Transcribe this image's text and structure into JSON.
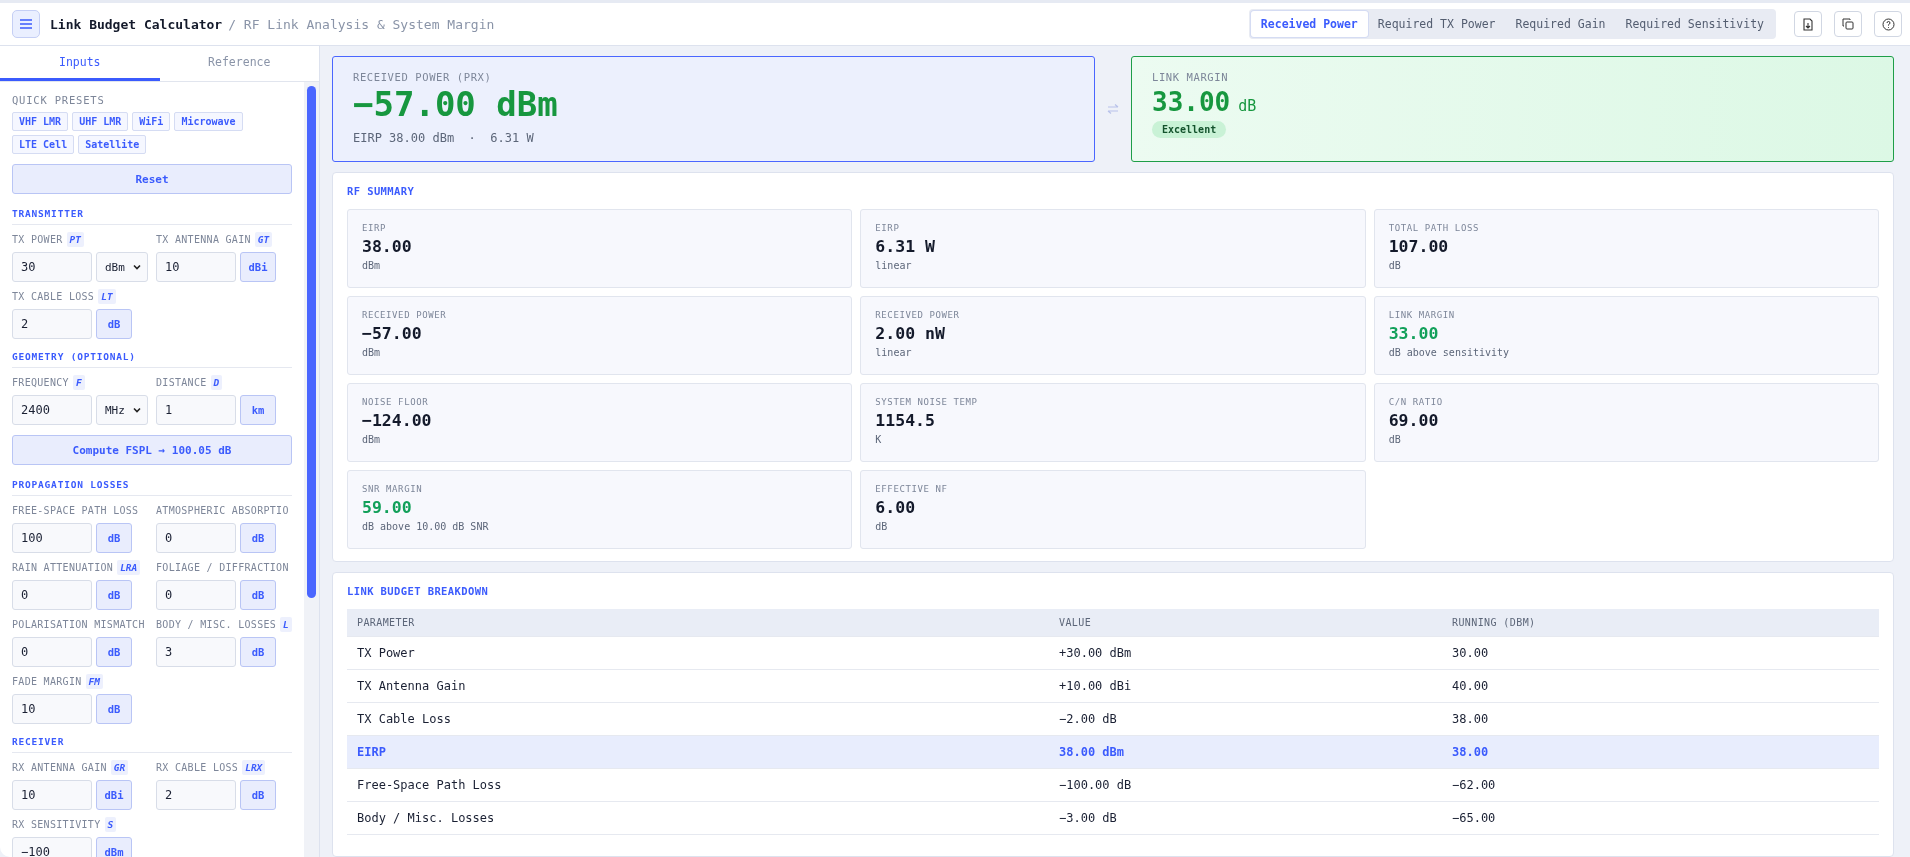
{
  "header": {
    "title": "Link Budget Calculator",
    "subtitle": "/ RF Link Analysis & System Margin",
    "modes": [
      {
        "label": "Received Power",
        "selected": true
      },
      {
        "label": "Required TX Power",
        "selected": false
      },
      {
        "label": "Required Gain",
        "selected": false
      },
      {
        "label": "Required Sensitivity",
        "selected": false
      }
    ]
  },
  "sidebar": {
    "tabs": [
      {
        "label": "Inputs",
        "selected": true
      },
      {
        "label": "Reference",
        "selected": false
      }
    ],
    "presets_title": "QUICK PRESETS",
    "presets": [
      "VHF LMR",
      "UHF LMR",
      "WiFi",
      "Microwave",
      "LTE Cell",
      "Satellite"
    ],
    "reset": "Reset",
    "sections": [
      {
        "title": "TRANSMITTER",
        "fields": [
          {
            "label": "TX POWER",
            "symbol": "PT",
            "value": "30",
            "unit": "dBm",
            "kind": "select"
          },
          {
            "label": "TX ANTENNA GAIN",
            "symbol": "GT",
            "value": "10",
            "unit": "dBi",
            "kind": "unit"
          },
          {
            "label": "TX CABLE LOSS",
            "symbol": "LT",
            "value": "2",
            "unit": "dB",
            "kind": "unit"
          }
        ]
      },
      {
        "title": "GEOMETRY (OPTIONAL)",
        "fields": [
          {
            "label": "FREQUENCY",
            "symbol": "F",
            "value": "2400",
            "unit": "MHz",
            "kind": "select"
          },
          {
            "label": "DISTANCE",
            "symbol": "D",
            "value": "1",
            "unit": "km",
            "kind": "unit"
          }
        ],
        "button": "Compute FSPL → 100.05 dB"
      },
      {
        "title": "PROPAGATION LOSSES",
        "fields": [
          {
            "label": "FREE-SPACE PATH LOSS",
            "value": "100",
            "unit": "dB",
            "kind": "unit"
          },
          {
            "label": "ATMOSPHERIC ABSORPTIO",
            "value": "0",
            "unit": "dB",
            "kind": "unit"
          },
          {
            "label": "RAIN ATTENUATION",
            "symbol": "LRA",
            "value": "0",
            "unit": "dB",
            "kind": "unit"
          },
          {
            "label": "FOLIAGE / DIFFRACTION",
            "value": "0",
            "unit": "dB",
            "kind": "unit"
          },
          {
            "label": "POLARISATION MISMATCH",
            "value": "0",
            "unit": "dB",
            "kind": "unit"
          },
          {
            "label": "BODY / MISC. LOSSES",
            "symbol": "L",
            "value": "3",
            "unit": "dB",
            "kind": "unit"
          },
          {
            "label": "FADE MARGIN",
            "symbol": "FM",
            "value": "10",
            "unit": "dB",
            "kind": "unit"
          }
        ]
      },
      {
        "title": "RECEIVER",
        "fields": [
          {
            "label": "RX ANTENNA GAIN",
            "symbol": "GR",
            "value": "10",
            "unit": "dBi",
            "kind": "unit"
          },
          {
            "label": "RX CABLE LOSS",
            "symbol": "LRX",
            "value": "2",
            "unit": "dB",
            "kind": "unit"
          },
          {
            "label": "RX SENSITIVITY",
            "symbol": "S",
            "value": "−100",
            "unit": "dBm",
            "kind": "unit"
          }
        ]
      }
    ]
  },
  "result": {
    "label": "RECEIVED POWER (PRX)",
    "value": "−57.00 dBm",
    "detail": "EIRP 38.00 dBm  ·  6.31 W"
  },
  "margin": {
    "label": "LINK MARGIN",
    "value": "33.00",
    "unit": "dB",
    "badge": "Excellent"
  },
  "summary": {
    "title": "RF SUMMARY",
    "tiles": [
      {
        "label": "EIRP",
        "value": "38.00",
        "unit": "dBm",
        "good": false
      },
      {
        "label": "EIRP",
        "value": "6.31 W",
        "unit": "linear",
        "good": false
      },
      {
        "label": "TOTAL PATH LOSS",
        "value": "107.00",
        "unit": "dB",
        "good": false
      },
      {
        "label": "RECEIVED POWER",
        "value": "−57.00",
        "unit": "dBm",
        "good": false
      },
      {
        "label": "RECEIVED POWER",
        "value": "2.00 nW",
        "unit": "linear",
        "good": false
      },
      {
        "label": "LINK MARGIN",
        "value": "33.00",
        "unit": "dB above sensitivity",
        "good": true
      },
      {
        "label": "NOISE FLOOR",
        "value": "−124.00",
        "unit": "dBm",
        "good": false
      },
      {
        "label": "SYSTEM NOISE TEMP",
        "value": "1154.5",
        "unit": "K",
        "good": false
      },
      {
        "label": "C/N RATIO",
        "value": "69.00",
        "unit": "dB",
        "good": false
      },
      {
        "label": "SNR MARGIN",
        "value": "59.00",
        "unit": "dB above 10.00 dB SNR",
        "good": true
      },
      {
        "label": "EFFECTIVE NF",
        "value": "6.00",
        "unit": "dB",
        "good": false
      }
    ]
  },
  "breakdown": {
    "title": "LINK BUDGET BREAKDOWN",
    "columns": [
      "PARAMETER",
      "VALUE",
      "RUNNING (DBM)"
    ],
    "rows": [
      {
        "cells": [
          "TX Power",
          "+30.00 dBm",
          "30.00"
        ],
        "highlighted": false
      },
      {
        "cells": [
          "TX Antenna Gain",
          "+10.00 dBi",
          "40.00"
        ],
        "highlighted": false
      },
      {
        "cells": [
          "TX Cable Loss",
          "−2.00 dB",
          "38.00"
        ],
        "highlighted": false
      },
      {
        "cells": [
          "EIRP",
          "38.00 dBm",
          "38.00"
        ],
        "highlighted": true
      },
      {
        "cells": [
          "Free-Space Path Loss",
          "−100.00 dB",
          "−62.00"
        ],
        "highlighted": false
      },
      {
        "cells": [
          "Body / Misc. Losses",
          "−3.00 dB",
          "−65.00"
        ],
        "highlighted": false
      }
    ]
  }
}
